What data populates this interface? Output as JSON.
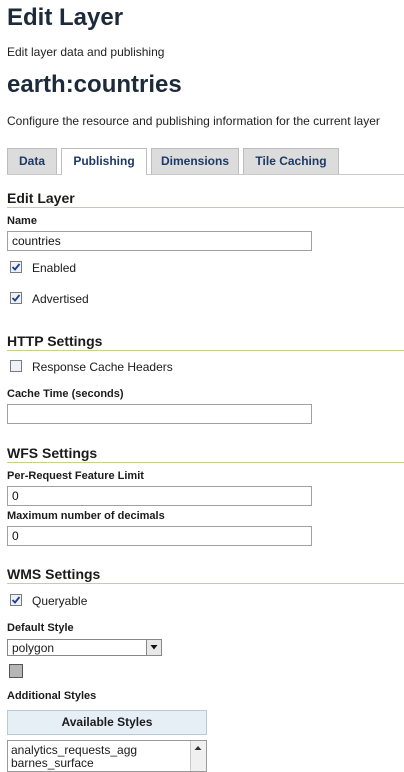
{
  "page": {
    "title": "Edit Layer",
    "subtitle": "Edit layer data and publishing",
    "layer_name": "earth:countries",
    "layer_description": "Configure the resource and publishing information for the current layer"
  },
  "tabs": [
    {
      "label": "Data",
      "active": false
    },
    {
      "label": "Publishing",
      "active": true
    },
    {
      "label": "Dimensions",
      "active": false
    },
    {
      "label": "Tile Caching",
      "active": false
    }
  ],
  "edit_layer": {
    "heading": "Edit Layer",
    "name_label": "Name",
    "name_value": "countries",
    "enabled_label": "Enabled",
    "enabled": true,
    "advertised_label": "Advertised",
    "advertised": true
  },
  "http": {
    "heading": "HTTP Settings",
    "cache_headers_label": "Response Cache Headers",
    "cache_headers": false,
    "cache_time_label": "Cache Time (seconds)",
    "cache_time_value": ""
  },
  "wfs": {
    "heading": "WFS Settings",
    "feature_limit_label": "Per-Request Feature Limit",
    "feature_limit_value": "0",
    "decimals_label": "Maximum number of decimals",
    "decimals_value": "0"
  },
  "wms": {
    "heading": "WMS Settings",
    "queryable_label": "Queryable",
    "queryable": true,
    "default_style_label": "Default Style",
    "default_style_value": "polygon",
    "additional_styles_label": "Additional Styles",
    "available_styles_label": "Available Styles",
    "available_styles": [
      "analytics_requests_agg",
      "barnes_surface"
    ]
  }
}
